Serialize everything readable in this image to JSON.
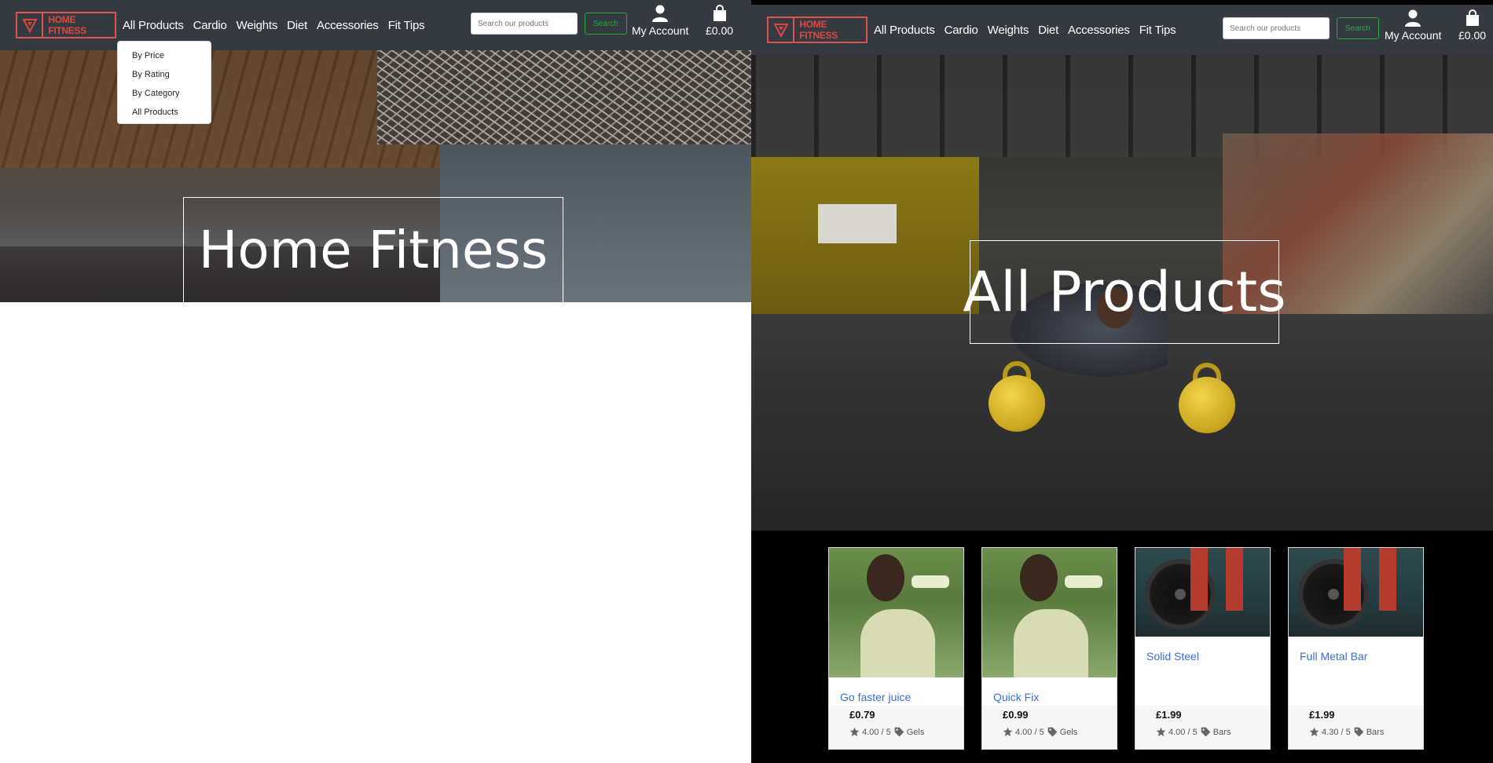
{
  "brand": {
    "name": "HOME FITNESS",
    "accent": "#e0463f"
  },
  "nav": {
    "links": [
      "All Products",
      "Cardio",
      "Weights",
      "Diet",
      "Accessories",
      "Fit Tips"
    ],
    "search_placeholder": "Search our products",
    "search_button": "Search",
    "account_label": "My Account",
    "cart_total": "£0.00",
    "account_icon": "user-icon",
    "cart_icon": "shopping-bag-icon"
  },
  "dropdown": {
    "items": [
      "By Price",
      "By Rating",
      "By Category",
      "All Products"
    ]
  },
  "left": {
    "hero_title": "Home Fitness"
  },
  "right": {
    "hero_title": "All Products",
    "products": [
      {
        "name": "Go faster juice",
        "price": "£0.79",
        "rating": "4.00 / 5",
        "category": "Gels"
      },
      {
        "name": "Quick Fix",
        "price": "£0.99",
        "rating": "4.00 / 5",
        "category": "Gels"
      },
      {
        "name": "Solid Steel",
        "price": "£1.99",
        "rating": "4.00 / 5",
        "category": "Bars"
      },
      {
        "name": "Full Metal Bar",
        "price": "£1.99",
        "rating": "4.30 / 5",
        "category": "Bars"
      }
    ]
  }
}
